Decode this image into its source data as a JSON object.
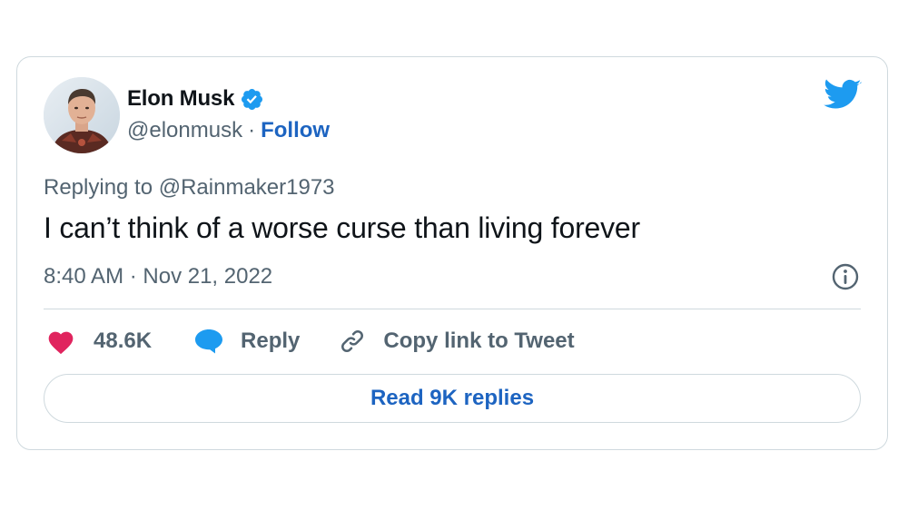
{
  "author": {
    "display_name": "Elon Musk",
    "handle": "@elonmusk",
    "separator": "·",
    "follow_label": "Follow",
    "avatar_icon": "avatar-photo",
    "verified_icon": "verified-badge-icon"
  },
  "tweet": {
    "replying_to": "Replying to @Rainmaker1973",
    "text": "I can’t think of a worse curse than living forever",
    "timestamp": "8:40 AM · Nov 21, 2022"
  },
  "actions": {
    "likes_count": "48.6K",
    "reply_label": "Reply",
    "copy_link_label": "Copy link to Tweet",
    "read_replies_label": "Read 9K replies"
  },
  "colors": {
    "accent_blue": "#1d64c1",
    "twitter_blue": "#1d9bf0",
    "heart_pink": "#e0245e",
    "reply_blue": "#1d9bf0",
    "muted_text": "#536471",
    "border": "#cfd9de"
  }
}
